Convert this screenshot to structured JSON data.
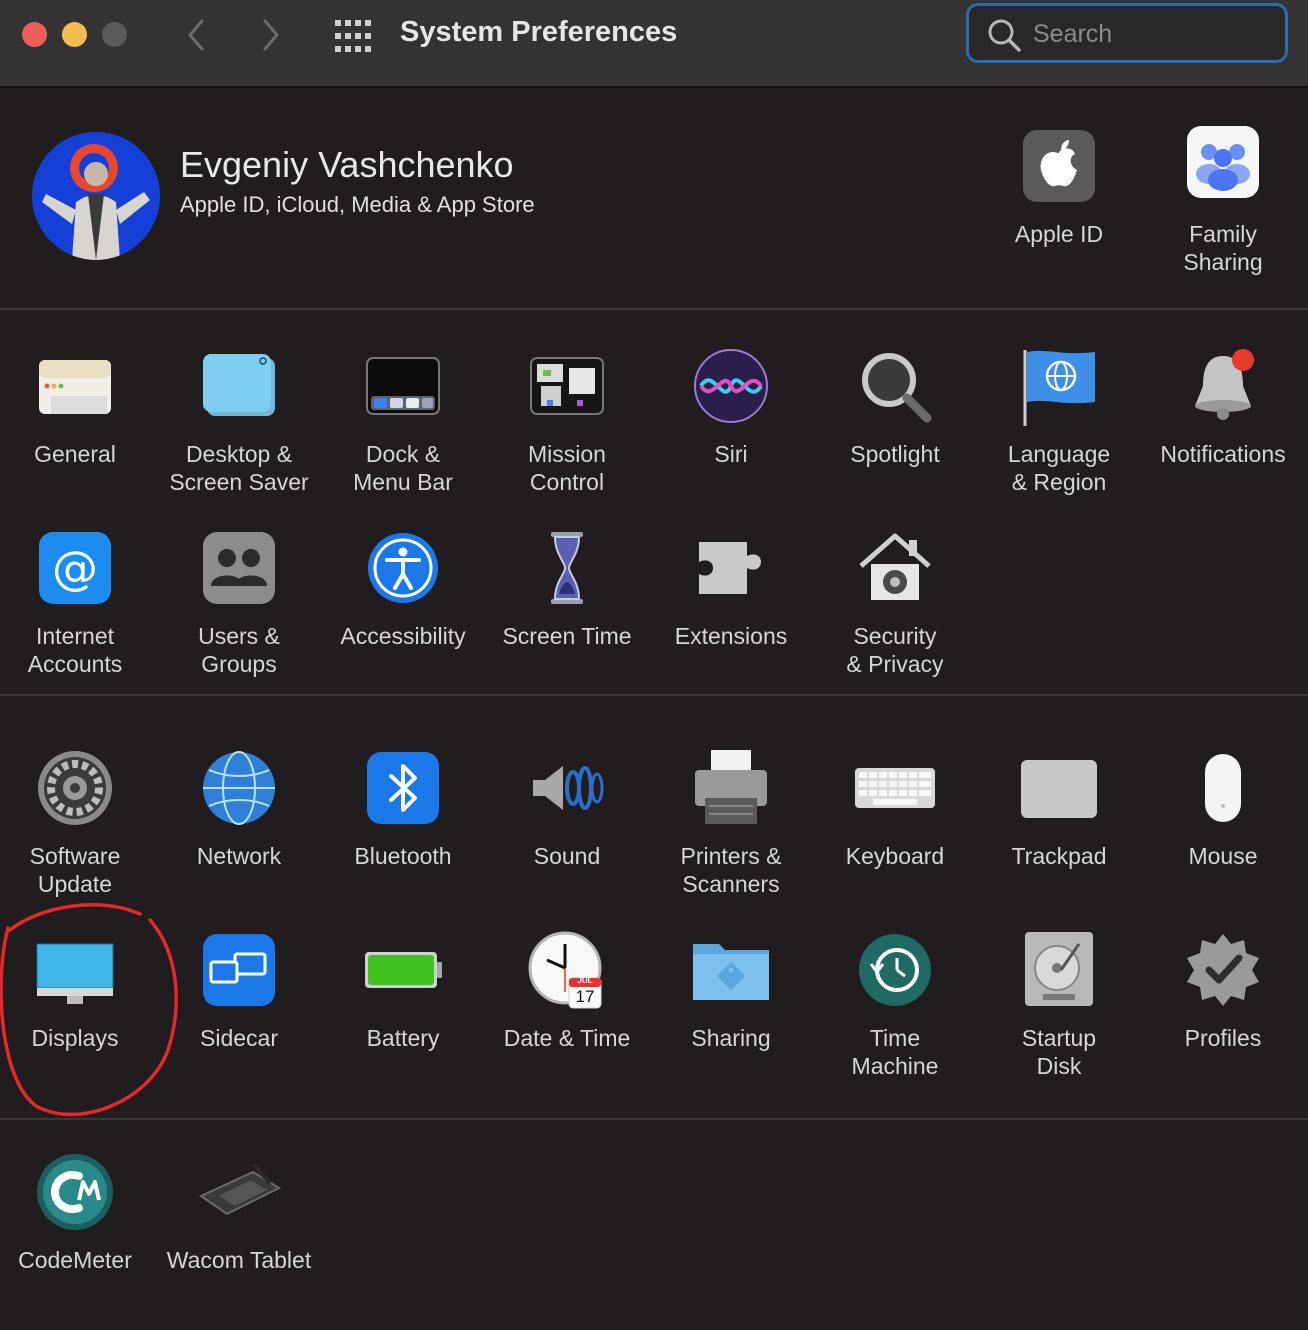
{
  "window": {
    "title": "System Preferences",
    "search_placeholder": "Search"
  },
  "account": {
    "name": "Evgeniy Vashchenko",
    "subtitle": "Apple ID, iCloud, Media & App Store",
    "apple_id_label": "Apple ID",
    "family_label_1": "Family",
    "family_label_2": "Sharing"
  },
  "row1": [
    {
      "l1": "General",
      "l2": ""
    },
    {
      "l1": "Desktop &",
      "l2": "Screen Saver"
    },
    {
      "l1": "Dock &",
      "l2": "Menu Bar"
    },
    {
      "l1": "Mission",
      "l2": "Control"
    },
    {
      "l1": "Siri",
      "l2": ""
    },
    {
      "l1": "Spotlight",
      "l2": ""
    },
    {
      "l1": "Language",
      "l2": "& Region"
    },
    {
      "l1": "Notifications",
      "l2": ""
    }
  ],
  "row2": [
    {
      "l1": "Internet",
      "l2": "Accounts"
    },
    {
      "l1": "Users &",
      "l2": "Groups"
    },
    {
      "l1": "Accessibility",
      "l2": ""
    },
    {
      "l1": "Screen Time",
      "l2": ""
    },
    {
      "l1": "Extensions",
      "l2": ""
    },
    {
      "l1": "Security",
      "l2": "& Privacy"
    }
  ],
  "row3": [
    {
      "l1": "Software",
      "l2": "Update"
    },
    {
      "l1": "Network",
      "l2": ""
    },
    {
      "l1": "Bluetooth",
      "l2": ""
    },
    {
      "l1": "Sound",
      "l2": ""
    },
    {
      "l1": "Printers &",
      "l2": "Scanners"
    },
    {
      "l1": "Keyboard",
      "l2": ""
    },
    {
      "l1": "Trackpad",
      "l2": ""
    },
    {
      "l1": "Mouse",
      "l2": ""
    }
  ],
  "row4": [
    {
      "l1": "Displays",
      "l2": ""
    },
    {
      "l1": "Sidecar",
      "l2": ""
    },
    {
      "l1": "Battery",
      "l2": ""
    },
    {
      "l1": "Date & Time",
      "l2": ""
    },
    {
      "l1": "Sharing",
      "l2": ""
    },
    {
      "l1": "Time",
      "l2": "Machine"
    },
    {
      "l1": "Startup",
      "l2": "Disk"
    },
    {
      "l1": "Profiles",
      "l2": ""
    }
  ],
  "row5": [
    {
      "l1": "CodeMeter",
      "l2": ""
    },
    {
      "l1": "Wacom Tablet",
      "l2": ""
    }
  ],
  "calendar": {
    "month": "JUL",
    "day": "17"
  },
  "colors": {
    "background": "#211d1e",
    "titlebar": "#353234",
    "search_focus": "#2c6ab1",
    "annotation": "#e4282c"
  }
}
